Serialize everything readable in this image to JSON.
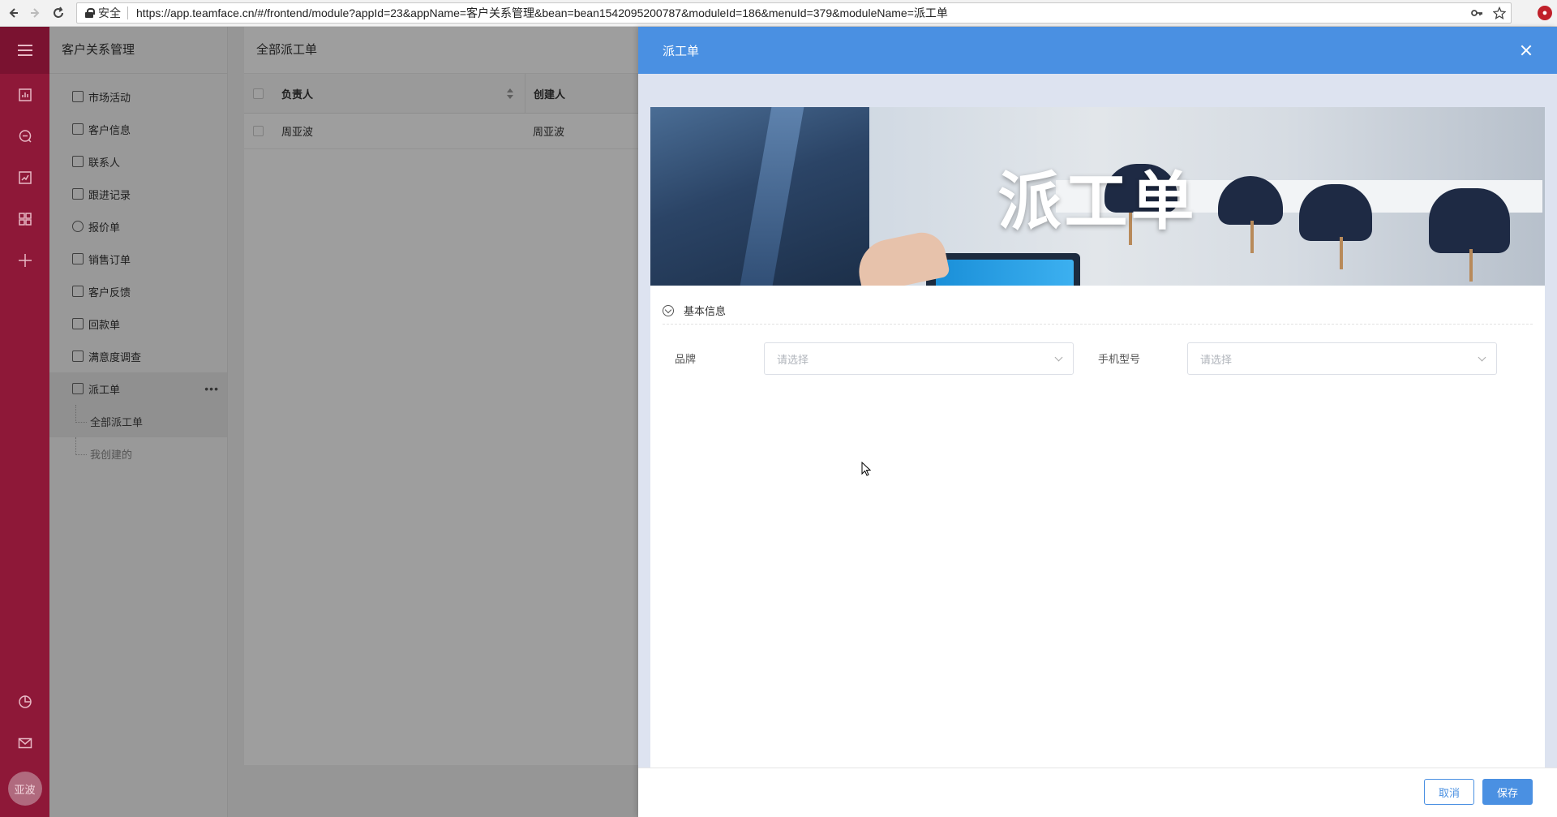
{
  "browser": {
    "secure_label": "安全",
    "url": "https://app.teamface.cn/#/frontend/module?appId=23&appName=客户关系管理&bean=bean1542095200787&moduleId=186&menuId=379&moduleName=派工单"
  },
  "rail": {
    "avatar_text": "亚波",
    "icons": [
      "menu-icon",
      "dashboard-icon",
      "chat-icon",
      "report-icon",
      "apps-icon",
      "add-icon",
      "pie-chart-icon",
      "mail-icon"
    ]
  },
  "sidebar": {
    "title": "客户关系管理",
    "items": [
      {
        "label": "市场活动"
      },
      {
        "label": "客户信息"
      },
      {
        "label": "联系人"
      },
      {
        "label": "跟进记录"
      },
      {
        "label": "报价单"
      },
      {
        "label": "销售订单"
      },
      {
        "label": "客户反馈"
      },
      {
        "label": "回款单"
      },
      {
        "label": "满意度调查"
      },
      {
        "label": "派工单"
      }
    ],
    "sub_items": [
      {
        "label": "全部派工单"
      },
      {
        "label": "我创建的"
      }
    ]
  },
  "main": {
    "title": "全部派工单",
    "columns": [
      "负责人",
      "创建人"
    ],
    "rows": [
      [
        "周亚波",
        "周亚波"
      ]
    ]
  },
  "drawer": {
    "title": "派工单",
    "banner_title": "派工单",
    "section_title": "基本信息",
    "fields": [
      {
        "label": "品牌",
        "placeholder": "请选择"
      },
      {
        "label": "手机型号",
        "placeholder": "请选择"
      }
    ],
    "cancel_label": "取消",
    "save_label": "保存"
  },
  "colors": {
    "rail": "#8e1838",
    "accent": "#4a90e2"
  }
}
